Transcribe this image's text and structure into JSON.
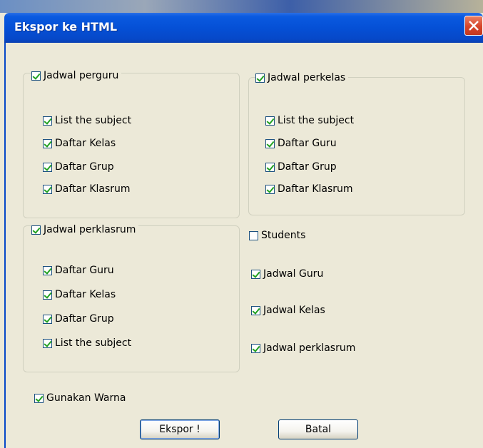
{
  "dialog": {
    "title": "Ekspor ke HTML"
  },
  "group_teacher": {
    "label": "Jadwal perguru",
    "checked": true,
    "items": [
      {
        "label": "List the subject",
        "checked": true
      },
      {
        "label": "Daftar Kelas",
        "checked": true
      },
      {
        "label": "Daftar Grup",
        "checked": true
      },
      {
        "label": "Daftar Klasrum",
        "checked": true
      }
    ]
  },
  "group_class": {
    "label": "Jadwal perkelas",
    "checked": true,
    "items": [
      {
        "label": "List the subject",
        "checked": true
      },
      {
        "label": "Daftar Guru",
        "checked": true
      },
      {
        "label": "Daftar Grup",
        "checked": true
      },
      {
        "label": "Daftar Klasrum",
        "checked": true
      }
    ]
  },
  "group_room": {
    "label": "Jadwal perklasrum",
    "checked": true,
    "items": [
      {
        "label": "Daftar Guru",
        "checked": true
      },
      {
        "label": "Daftar Kelas",
        "checked": true
      },
      {
        "label": "Daftar Grup",
        "checked": true
      },
      {
        "label": "List the subject",
        "checked": true
      }
    ]
  },
  "group_students": {
    "label": "Students",
    "checked": false,
    "items": [
      {
        "label": "Jadwal Guru",
        "checked": true
      },
      {
        "label": "Jadwal Kelas",
        "checked": true
      },
      {
        "label": "Jadwal perklasrum",
        "checked": true
      }
    ]
  },
  "use_color": {
    "label": "Gunakan Warna",
    "checked": true
  },
  "buttons": {
    "export_label": "Ekspor !",
    "cancel_label": "Batal"
  },
  "colors": {
    "title_bar": "#0550d6",
    "dialog_bg": "#ece9d8",
    "check_mark": "#21a121",
    "close_button": "#d6452a"
  }
}
